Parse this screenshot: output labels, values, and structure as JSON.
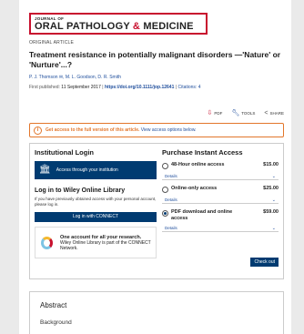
{
  "journal": {
    "prefix": "JOURNAL OF",
    "name_part1": "ORAL PATHOLOGY ",
    "amp": "&",
    "name_part2": " MEDICINE"
  },
  "article": {
    "type": "ORIGINAL ARTICLE",
    "title": "Treatment resistance in potentially malignant disorders —'Nature' or 'Nurture'...?",
    "authors": "P. J. Thomson ✉, M. L. Goodson, D. R. Smith",
    "published_label": "First published: ",
    "published_date": "11 September 2017",
    "doi": "https://doi.org/10.1111/jop.12641",
    "citations": "Citations: 4"
  },
  "toolbar": {
    "pdf_label": "PDF",
    "tools_label": "TOOLS",
    "share_label": "SHARE"
  },
  "access": {
    "message": "Get access to the full version of this article.",
    "link": " View access options below."
  },
  "institutional": {
    "title": "Institutional Login",
    "button_label": "Access through your institution",
    "login_title": "Log in to Wiley Online Library",
    "login_desc": "If you have previously obtained access with your personal account, please log in.",
    "connect_button": "Log in with CONNECT",
    "account_title": "One account for all your research.",
    "account_desc": "Wiley Online Library is part of the CONNECT Network."
  },
  "purchase": {
    "title": "Purchase Instant Access",
    "options": [
      {
        "label": "48-Hour online access",
        "price": "$15.00",
        "details": "Details",
        "checked": false
      },
      {
        "label": "Online-only access",
        "price": "$25.00",
        "details": "Details",
        "checked": false
      },
      {
        "label": "PDF download and online access",
        "price": "$59.00",
        "details": "Details",
        "checked": true
      }
    ],
    "checkout": "Check out"
  },
  "abstract": {
    "title": "Abstract",
    "subtitle": "Background"
  },
  "colors": {
    "brand_red": "#c8102e",
    "navy": "#003b71",
    "link_blue": "#1f4e9c",
    "warning_orange": "#e2762b"
  }
}
